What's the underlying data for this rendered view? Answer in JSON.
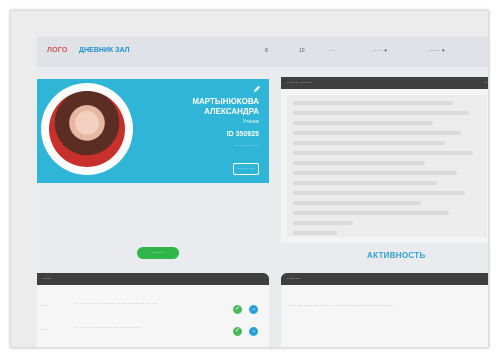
{
  "header": {
    "logo_accent": "ЛОГО",
    "logo_text": "ДНЕВНИК ЗАЛ",
    "nav": [
      "8",
      "10",
      "····",
      "······ ▾",
      "······· ▾"
    ]
  },
  "profile": {
    "last_name": "МАРТЫНЮКОВА",
    "first_name": "АЛЕКСАНДРА",
    "role": "Ученик",
    "id": "ID 350925",
    "sub": "········ ······",
    "button_label": "······ ···",
    "green_button_label": "·······"
  },
  "right_panel": {
    "header": "······· ·······",
    "header_right": "····"
  },
  "activity": {
    "title": "АКТИВНОСТЬ"
  },
  "left_panel": {
    "header": "·····",
    "rows": [
      {
        "label": "·····",
        "text": "········ ········· ········ ······· ··········· ········"
      },
      {
        "label": "·····",
        "text": "········ ······ ········· ········ ··········"
      }
    ]
  },
  "bottom_right_panel": {
    "header": "········",
    "text": "········· ·········· ······ ·· ······· ············· ········ ·········"
  },
  "colors": {
    "profile_card": "#2eb5d8",
    "accent_blue": "#2a9fd6",
    "green": "#2fb54a",
    "dark_header": "#3f3f3f",
    "logo_red": "#d9534f"
  },
  "icons": {
    "edit": "pencil-icon",
    "approve": "check-icon",
    "open": "arrow-icon"
  }
}
